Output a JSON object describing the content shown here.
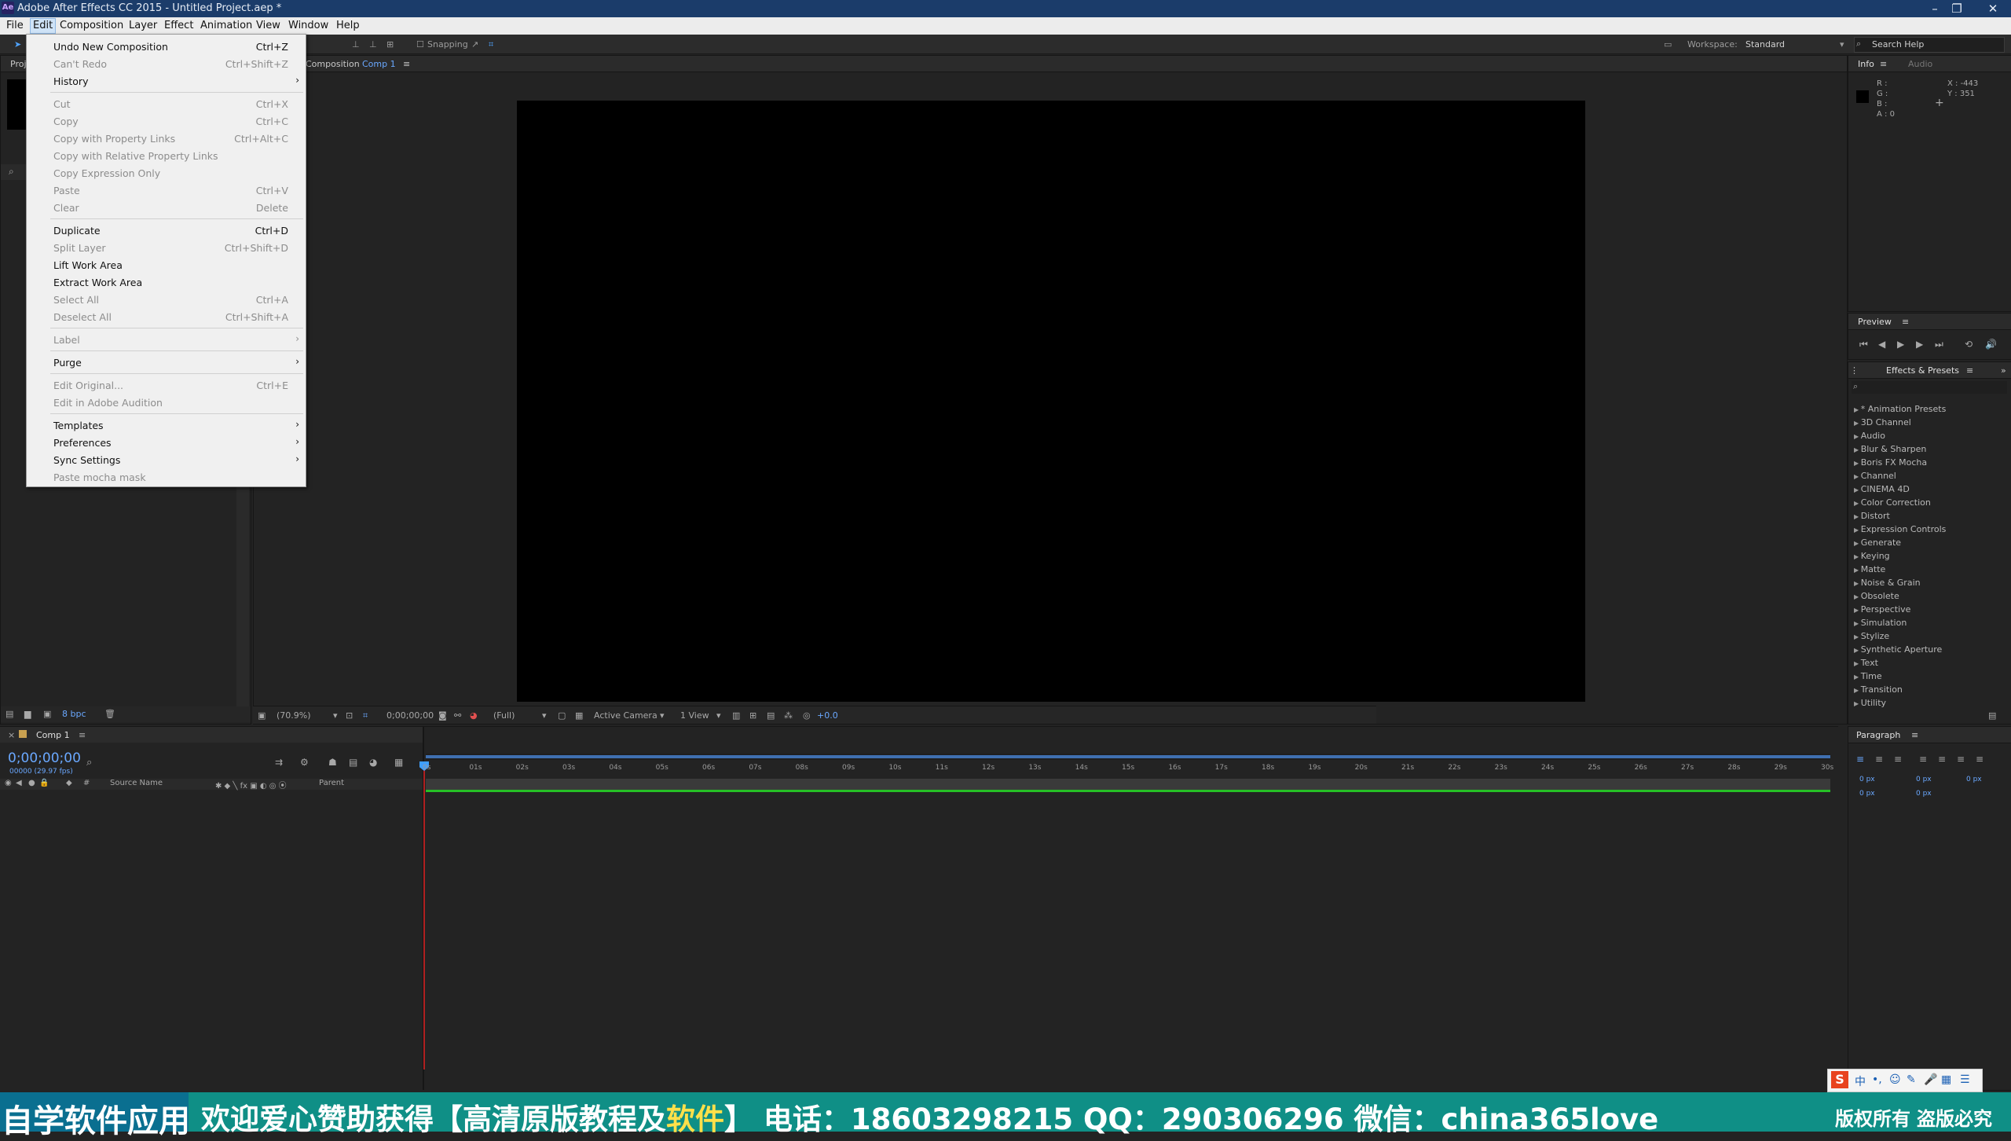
{
  "window": {
    "title": "Adobe After Effects CC 2015 - Untitled Project.aep *",
    "app_icon": "Ae"
  },
  "menubar": [
    "File",
    "Edit",
    "Composition",
    "Layer",
    "Effect",
    "Animation",
    "View",
    "Window",
    "Help"
  ],
  "toolbar": {
    "snapping": "Snapping",
    "workspace_label": "Workspace:",
    "workspace_value": "Standard",
    "search_placeholder": "Search Help"
  },
  "project_panel": {
    "tab": "Proj",
    "bpc": "8 bpc"
  },
  "composition_panel": {
    "tab_prefix": "Composition",
    "tab_comp": "Comp 1",
    "zoom": "(70.9%)",
    "timecode": "0;00;00;00",
    "resolution": "(Full)",
    "camera": "Active Camera",
    "views": "1 View",
    "exposure": "+0.0"
  },
  "info_panel": {
    "tab_info": "Info",
    "tab_audio": "Audio",
    "r": "R :",
    "g": "G :",
    "b": "B :",
    "a": "A : 0",
    "x": "X : -443",
    "y": "Y : 351"
  },
  "preview_panel": {
    "tab": "Preview"
  },
  "effects_panel": {
    "tab": "Effects & Presets",
    "items": [
      "* Animation Presets",
      "3D Channel",
      "Audio",
      "Blur & Sharpen",
      "Boris FX Mocha",
      "Channel",
      "CINEMA 4D",
      "Color Correction",
      "Distort",
      "Expression Controls",
      "Generate",
      "Keying",
      "Matte",
      "Noise & Grain",
      "Obsolete",
      "Perspective",
      "Simulation",
      "Stylize",
      "Synthetic Aperture",
      "Text",
      "Time",
      "Transition",
      "Utility"
    ]
  },
  "paragraph_panel": {
    "tab": "Paragraph",
    "val": "0 px"
  },
  "timeline": {
    "tab": "Comp 1",
    "timecode": "0;00;00;00",
    "fps": "00000 (29.97 fps)",
    "col_source": "Source Name",
    "col_parent": "Parent",
    "ruler": [
      "0s",
      "01s",
      "02s",
      "03s",
      "04s",
      "05s",
      "06s",
      "07s",
      "08s",
      "09s",
      "10s",
      "11s",
      "12s",
      "13s",
      "14s",
      "15s",
      "16s",
      "17s",
      "18s",
      "19s",
      "20s",
      "21s",
      "22s",
      "23s",
      "24s",
      "25s",
      "26s",
      "27s",
      "28s",
      "29s",
      "30s"
    ]
  },
  "edit_menu": {
    "items": [
      {
        "label": "Undo New Composition",
        "shortcut": "Ctrl+Z",
        "enabled": true
      },
      {
        "label": "Can't Redo",
        "shortcut": "Ctrl+Shift+Z",
        "enabled": false
      },
      {
        "label": "History",
        "shortcut": "",
        "enabled": true,
        "submenu": true
      },
      {
        "sep": true
      },
      {
        "label": "Cut",
        "shortcut": "Ctrl+X",
        "enabled": false
      },
      {
        "label": "Copy",
        "shortcut": "Ctrl+C",
        "enabled": false
      },
      {
        "label": "Copy with Property Links",
        "shortcut": "Ctrl+Alt+C",
        "enabled": false
      },
      {
        "label": "Copy with Relative Property Links",
        "shortcut": "",
        "enabled": false
      },
      {
        "label": "Copy Expression Only",
        "shortcut": "",
        "enabled": false
      },
      {
        "label": "Paste",
        "shortcut": "Ctrl+V",
        "enabled": false
      },
      {
        "label": "Clear",
        "shortcut": "Delete",
        "enabled": false
      },
      {
        "sep": true
      },
      {
        "label": "Duplicate",
        "shortcut": "Ctrl+D",
        "enabled": true
      },
      {
        "label": "Split Layer",
        "shortcut": "Ctrl+Shift+D",
        "enabled": false
      },
      {
        "label": "Lift Work Area",
        "shortcut": "",
        "enabled": true
      },
      {
        "label": "Extract Work Area",
        "shortcut": "",
        "enabled": true
      },
      {
        "label": "Select All",
        "shortcut": "Ctrl+A",
        "enabled": false
      },
      {
        "label": "Deselect All",
        "shortcut": "Ctrl+Shift+A",
        "enabled": false
      },
      {
        "sep": true
      },
      {
        "label": "Label",
        "shortcut": "",
        "enabled": false,
        "submenu": true
      },
      {
        "sep": true
      },
      {
        "label": "Purge",
        "shortcut": "",
        "enabled": true,
        "submenu": true
      },
      {
        "sep": true
      },
      {
        "label": "Edit Original...",
        "shortcut": "Ctrl+E",
        "enabled": false
      },
      {
        "label": "Edit in Adobe Audition",
        "shortcut": "",
        "enabled": false
      },
      {
        "sep": true
      },
      {
        "label": "Templates",
        "shortcut": "",
        "enabled": true,
        "submenu": true
      },
      {
        "label": "Preferences",
        "shortcut": "",
        "enabled": true,
        "submenu": true
      },
      {
        "label": "Sync Settings",
        "shortcut": "",
        "enabled": true,
        "submenu": true
      },
      {
        "label": "Paste mocha mask",
        "shortcut": "",
        "enabled": false
      }
    ]
  },
  "banner": {
    "left": "自学软件应用",
    "main": "欢迎爱心赞助获得【高清原版教程及软件】 电话：18603298215 QQ：290306296 微信：china365love",
    "right1": "版权所有",
    "right2": "盗版必究"
  },
  "colors": {
    "accent_blue": "#6aa8ff",
    "timeline_green": "#26c026",
    "playhead_red": "#b02020",
    "banner_bg": "#0f8f86",
    "banner_yellow": "#ffe04a"
  }
}
